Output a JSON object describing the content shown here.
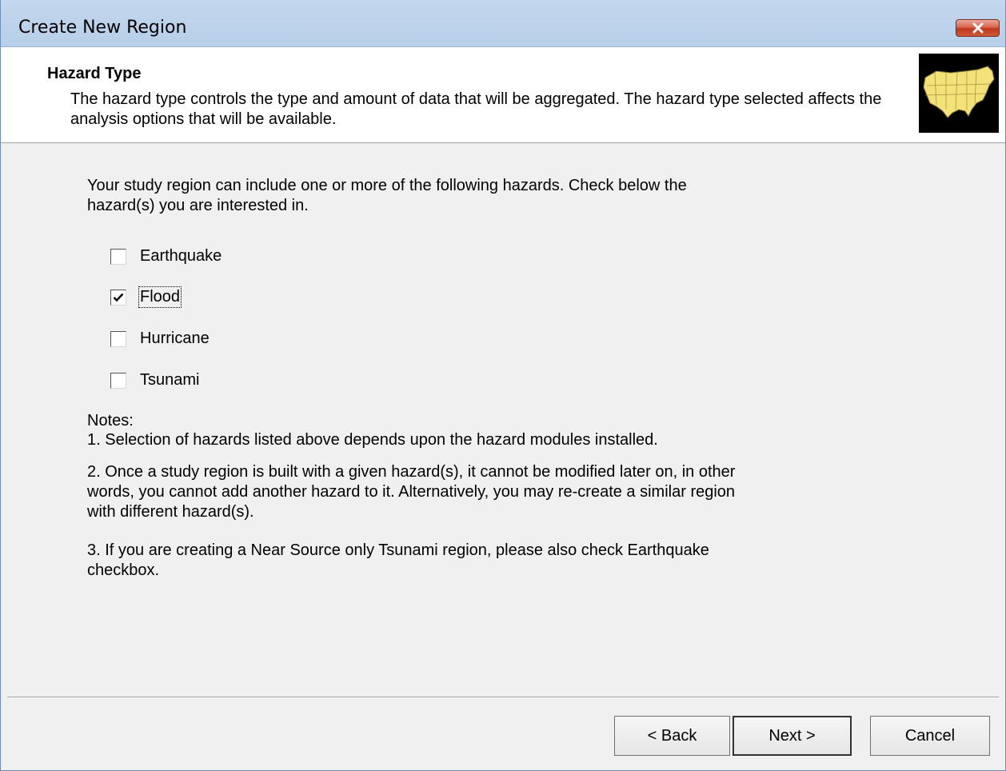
{
  "window": {
    "title": "Create New Region"
  },
  "header": {
    "title": "Hazard Type",
    "description": "The hazard type controls the type and amount of data that will be aggregated.  The hazard type selected affects the analysis options that will be available."
  },
  "content": {
    "intro": "Your study region can include one or more of the following hazards. Check below the hazard(s) you are interested in.",
    "hazards": [
      {
        "label": "Earthquake",
        "checked": false
      },
      {
        "label": "Flood",
        "checked": true
      },
      {
        "label": "Hurricane",
        "checked": false
      },
      {
        "label": "Tsunami",
        "checked": false
      }
    ],
    "notes_title": "Notes:",
    "notes": [
      "1. Selection of hazards listed above depends upon the hazard modules installed.",
      "2. Once a study region is built with a given hazard(s), it cannot be modified later on, in other words, you cannot add another hazard to it. Alternatively, you may re-create a similar region with different hazard(s).",
      "3. If you are creating a Near Source only Tsunami region, please also check Earthquake checkbox."
    ]
  },
  "footer": {
    "back_label": "< Back",
    "next_label": "Next >",
    "cancel_label": "Cancel"
  },
  "colors": {
    "titlebar": "#bdd3ec",
    "close_button": "#c1361a",
    "logo_background": "#000000",
    "map_fill": "#f3e27a"
  },
  "icons": {
    "close": "close-icon",
    "logo": "usa-map-icon",
    "checkmark": "checkmark-icon"
  }
}
